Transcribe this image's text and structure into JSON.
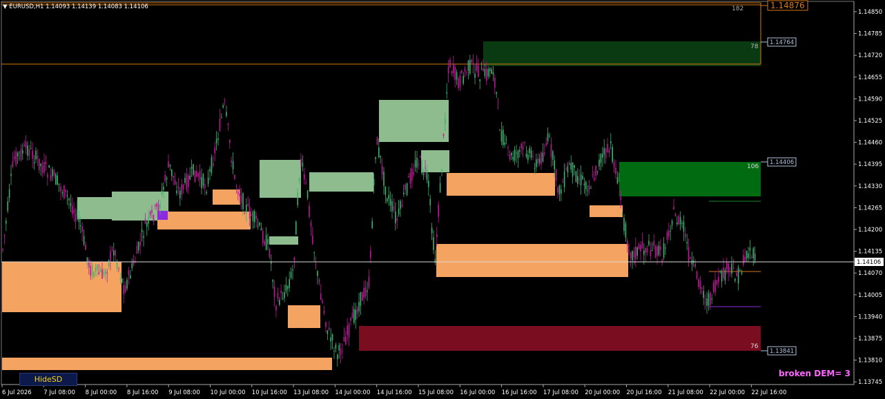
{
  "header": {
    "arrow": "▼",
    "text": "EURUSD,H1  1.14093 1.14139 1.14083 1.14106"
  },
  "price_axis": [
    "1.14850",
    "1.14785",
    "1.14720",
    "1.14655",
    "1.14590",
    "1.14525",
    "1.14460",
    "1.14395",
    "1.14330",
    "1.14265",
    "1.14200",
    "1.14135",
    "1.14070",
    "1.14005",
    "1.13940",
    "1.13875",
    "1.13810",
    "1.13745"
  ],
  "time_axis": [
    "6 Jul 2026",
    "7 Jul 08:00",
    "8 Jul 00:00",
    "8 Jul 16:00",
    "9 Jul 08:00",
    "10 Jul 00:00",
    "10 Jul 16:00",
    "13 Jul 08:00",
    "14 Jul 00:00",
    "14 Jul 16:00",
    "15 Jul 08:00",
    "16 Jul 00:00",
    "16 Jul 16:00",
    "17 Jul 08:00",
    "20 Jul 00:00",
    "20 Jul 16:00",
    "21 Jul 08:00",
    "22 Jul 00:00",
    "22 Jul 16:00"
  ],
  "current_price": "1.14106",
  "levels": [
    {
      "name": "top-orange",
      "price": "1.14876",
      "count": "182"
    },
    {
      "name": "upper-green",
      "price": "1.14764",
      "count": "78"
    },
    {
      "name": "mid-green",
      "price": "1.14406",
      "count": "106"
    },
    {
      "name": "lower-red",
      "price": "1.13841",
      "count": "76"
    }
  ],
  "controls": {
    "hide_label": "HideSD"
  },
  "status": {
    "broken_text": "broken DEM= 3"
  },
  "colors": {
    "bull": "#3cb371",
    "bear": "#c0169a",
    "supply_light": "#8fbc8f",
    "demand": "#f4a460",
    "dark_green": "#0b3b12",
    "green": "#006400",
    "red": "#7a0d1f",
    "orange_line": "#d97a10"
  }
}
